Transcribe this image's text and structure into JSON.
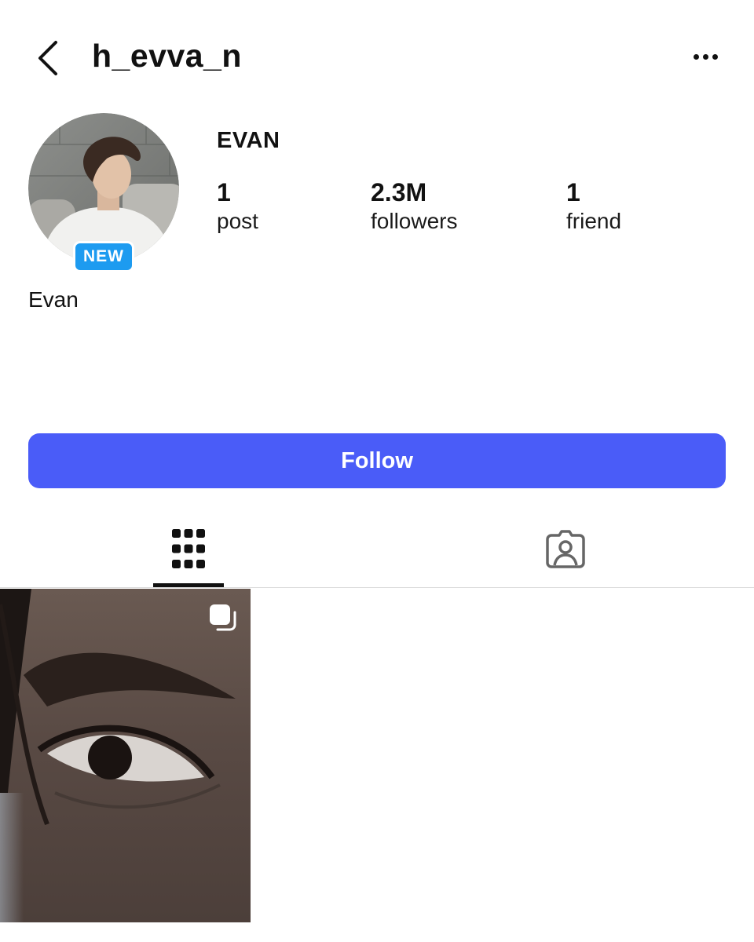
{
  "header": {
    "username": "h_evva_n",
    "back_icon": "chevron-left-icon",
    "more_icon": "more-horizontal-icon"
  },
  "profile": {
    "display_name": "EVAN",
    "badge": "NEW",
    "bio_name": "Evan",
    "stats": [
      {
        "value": "1",
        "label": "post"
      },
      {
        "value": "2.3M",
        "label": "followers"
      },
      {
        "value": "1",
        "label": "friend"
      }
    ]
  },
  "actions": {
    "follow_label": "Follow"
  },
  "tabs": [
    {
      "icon": "grid-icon",
      "active": true
    },
    {
      "icon": "tagged-person-icon",
      "active": false
    }
  ],
  "posts": [
    {
      "type": "carousel",
      "icon": "multiple-images-icon"
    }
  ],
  "colors": {
    "follow_button": "#4a5cf8",
    "badge": "#1d9bf0",
    "text": "#111111",
    "divider": "#dbdbdb"
  }
}
